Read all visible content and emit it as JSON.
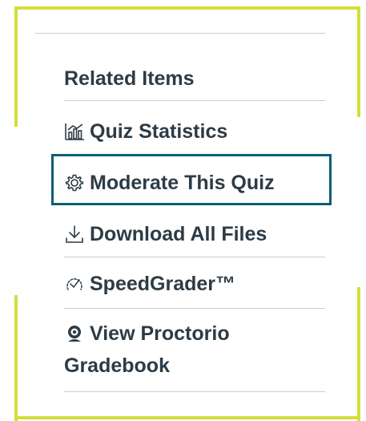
{
  "colors": {
    "accent_frame": "#d4de3b",
    "focus_outline": "#0a5e70",
    "text": "#2d3b45",
    "divider": "#c7cdd1"
  },
  "related": {
    "title": "Related Items",
    "items": [
      {
        "label": "Quiz Statistics",
        "icon": "bar-chart-icon"
      },
      {
        "label": "Moderate This Quiz",
        "icon": "gear-icon",
        "focused": true
      },
      {
        "label": "Download All Files",
        "icon": "download-icon"
      },
      {
        "label": "SpeedGrader™",
        "icon": "speedgrader-icon"
      },
      {
        "label_line1": "View Proctorio",
        "label_line2": "Gradebook",
        "icon": "proctorio-icon"
      }
    ]
  }
}
